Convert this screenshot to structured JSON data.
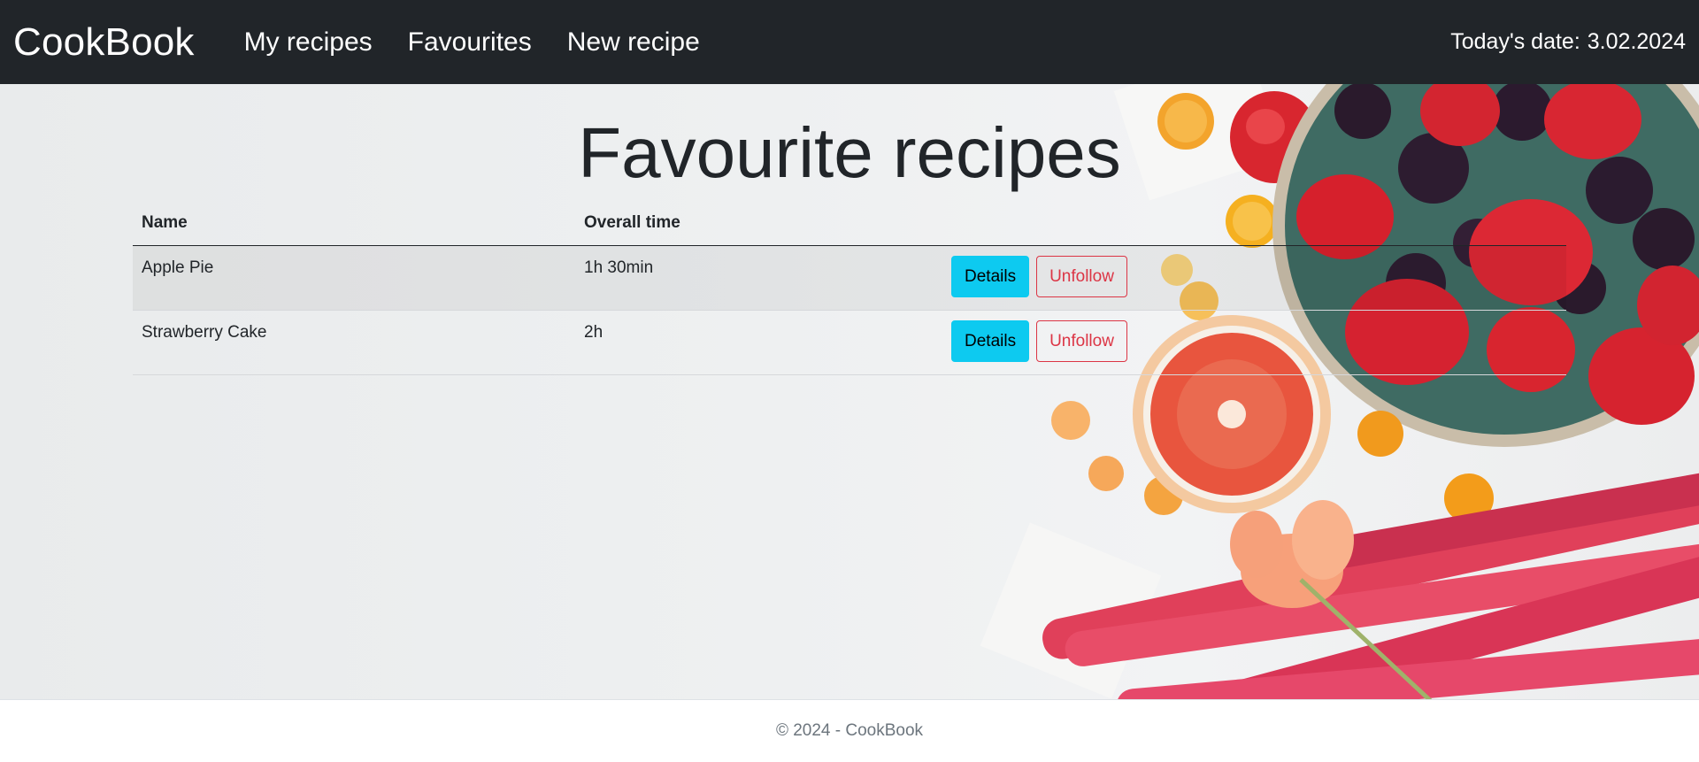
{
  "navbar": {
    "brand": "CookBook",
    "links": [
      {
        "label": "My recipes"
      },
      {
        "label": "Favourites"
      },
      {
        "label": "New recipe"
      }
    ],
    "date_label": "Today's date:",
    "date_value": "3.02.2024"
  },
  "main": {
    "title": "Favourite recipes",
    "table": {
      "headers": {
        "name": "Name",
        "time": "Overall time"
      },
      "rows": [
        {
          "name": "Apple Pie",
          "time": "1h 30min",
          "details": "Details",
          "unfollow": "Unfollow"
        },
        {
          "name": "Strawberry Cake",
          "time": "2h",
          "details": "Details",
          "unfollow": "Unfollow"
        }
      ]
    }
  },
  "footer": {
    "text": "© 2024 - CookBook"
  },
  "colors": {
    "navbar_bg": "#212529",
    "details_btn": "#0dcaf0",
    "unfollow_btn": "#dc3545"
  }
}
